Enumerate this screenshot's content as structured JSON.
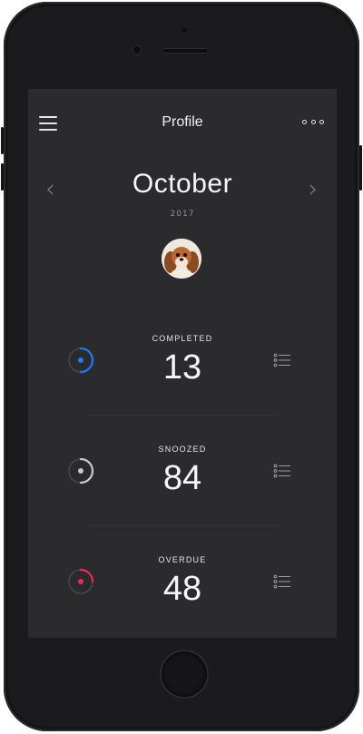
{
  "header": {
    "title": "Profile",
    "menu_icon": "hamburger-menu-icon",
    "more_icon": "more-options-icon"
  },
  "calendar": {
    "month": "October",
    "year": "2017",
    "prev_icon": "chevron-left-icon",
    "next_icon": "chevron-right-icon"
  },
  "profile": {
    "avatar_alt": "dog-avatar"
  },
  "stats": [
    {
      "label": "COMPLETED",
      "value": "13",
      "color": "#1e7bf0",
      "progress": 0.3
    },
    {
      "label": "SNOOZED",
      "value": "84",
      "color": "#c9c9c9",
      "progress": 0.3
    },
    {
      "label": "OVERDUE",
      "value": "48",
      "color": "#f0265a",
      "progress": 0.3
    }
  ],
  "colors": {
    "background": "#2b2b2d",
    "device": "#1b1b1d",
    "accent_blue": "#1e7bf0",
    "accent_red": "#f0265a"
  }
}
